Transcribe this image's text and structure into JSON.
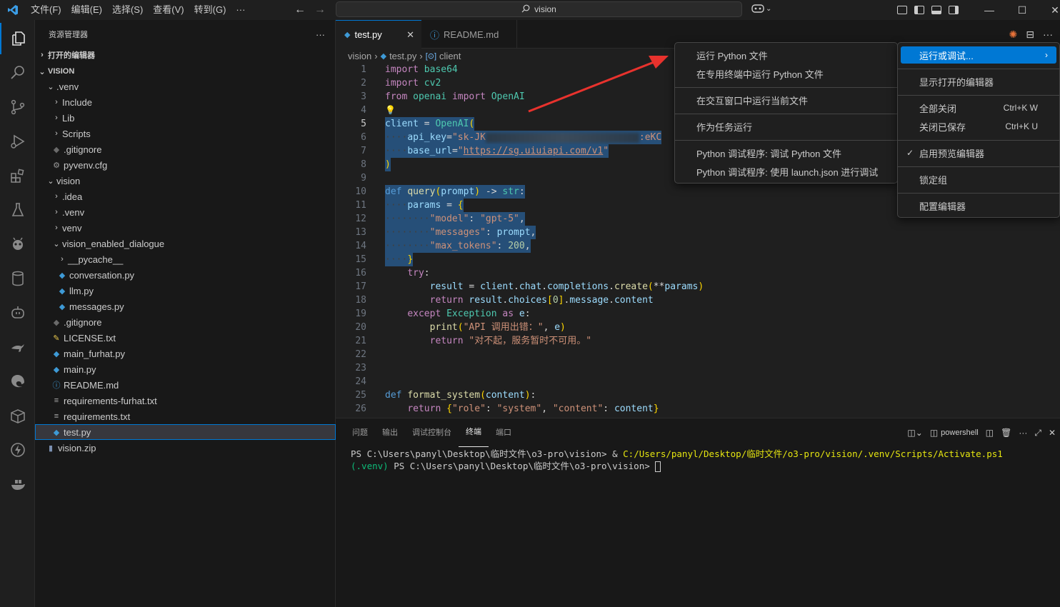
{
  "menu": [
    "文件(F)",
    "编辑(E)",
    "选择(S)",
    "查看(V)",
    "转到(G)",
    "···"
  ],
  "search": {
    "text": "vision"
  },
  "sidebar": {
    "title": "资源管理器",
    "more": "···",
    "open_editors": "打开的编辑器",
    "root": "VISION",
    "items": [
      {
        "label": ".venv"
      },
      {
        "label": "Include"
      },
      {
        "label": "Lib"
      },
      {
        "label": "Scripts"
      },
      {
        "label": ".gitignore"
      },
      {
        "label": "pyvenv.cfg"
      },
      {
        "label": "vision"
      },
      {
        "label": ".idea"
      },
      {
        "label": ".venv"
      },
      {
        "label": "venv"
      },
      {
        "label": "vision_enabled_dialogue"
      },
      {
        "label": "__pycache__"
      },
      {
        "label": "conversation.py"
      },
      {
        "label": "llm.py"
      },
      {
        "label": "messages.py"
      },
      {
        "label": ".gitignore"
      },
      {
        "label": "LICENSE.txt"
      },
      {
        "label": "main_furhat.py"
      },
      {
        "label": "main.py"
      },
      {
        "label": "README.md"
      },
      {
        "label": "requirements-furhat.txt"
      },
      {
        "label": "requirements.txt"
      },
      {
        "label": "test.py"
      },
      {
        "label": "vision.zip"
      }
    ]
  },
  "tabs": [
    {
      "label": "test.py"
    },
    {
      "label": "README.md"
    }
  ],
  "breadcrumb": [
    "vision",
    "test.py",
    "client"
  ],
  "code": {
    "line_numbers": [
      "1",
      "2",
      "3",
      "4",
      "5",
      "6",
      "7",
      "8",
      "9",
      "10",
      "11",
      "12",
      "13",
      "14",
      "15",
      "16",
      "17",
      "18",
      "19",
      "20",
      "21",
      "22",
      "23",
      "24",
      "25",
      "26"
    ],
    "l1a": "import",
    "l1b": "base64",
    "l2a": "import",
    "l2b": "cv2",
    "l3a": "from",
    "l3b": "openai",
    "l3c": "import",
    "l3d": "OpenAI",
    "l5a": "client",
    "l5b": "OpenAI",
    "l6a": "api_key",
    "l6b": "\"sk-JK",
    "l6c": ":eKC",
    "l7a": "base_url",
    "l7b": "\"",
    "l7c": "https://sg.uiuiapi.com/v1",
    "l7d": "\"",
    "l10a": "def",
    "l10b": "query",
    "l10c": "prompt",
    "l10d": "str",
    "l11a": "params",
    "l12a": "\"model\"",
    "l12b": "\"gpt-5\"",
    "l13a": "\"messages\"",
    "l13b": "prompt",
    "l14a": "\"max_tokens\"",
    "l14b": "200",
    "l16a": "try",
    "l17a": "result",
    "l17b": "client",
    "l17c": "chat",
    "l17d": "completions",
    "l17e": "create",
    "l17f": "params",
    "l18a": "return",
    "l18b": "result",
    "l18c": "choices",
    "l18d": "0",
    "l18e": "message",
    "l18f": "content",
    "l19a": "except",
    "l19b": "Exception",
    "l19c": "as",
    "l19d": "e",
    "l20a": "print",
    "l20b": "\"API 调用出错：\"",
    "l20c": "e",
    "l21a": "return",
    "l21b": "\"对不起，服务暂时不可用。\"",
    "l25a": "def",
    "l25b": "format_system",
    "l25c": "content",
    "l26a": "return",
    "l26b": "\"role\"",
    "l26c": "\"system\"",
    "l26d": "\"content\"",
    "l26e": "content"
  },
  "panel": {
    "tabs": [
      "问题",
      "输出",
      "调试控制台",
      "终端",
      "端口"
    ],
    "shell": "powershell",
    "term1_prompt": "PS C:\\Users\\panyl\\Desktop\\临时文件\\o3-pro\\vision> & ",
    "term1_cmd": "C:/Users/panyl/Desktop/临时文件/o3-pro/vision/.venv/Scripts/Activate.ps1",
    "term2_venv": "(.venv)",
    "term2_prompt": " PS C:\\Users\\panyl\\Desktop\\临时文件\\o3-pro\\vision> "
  },
  "run_menu": [
    "运行 Python 文件",
    "在专用终端中运行 Python 文件",
    "在交互窗口中运行当前文件",
    "作为任务运行",
    "Python 调试程序: 调试 Python 文件",
    "Python 调试程序: 使用 launch.json 进行调试"
  ],
  "more_menu": {
    "run_debug": "运行或调试...",
    "show_open": "显示打开的编辑器",
    "close_all": "全部关闭",
    "close_all_kbd": "Ctrl+K W",
    "close_saved": "关闭已保存",
    "close_saved_kbd": "Ctrl+K U",
    "preview": "启用预览编辑器",
    "lock": "锁定组",
    "configure": "配置编辑器"
  }
}
